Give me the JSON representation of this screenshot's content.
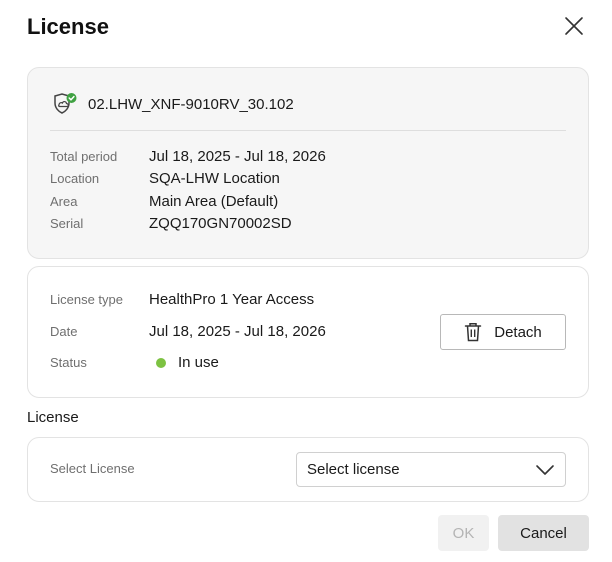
{
  "dialog": {
    "title": "License",
    "close_icon": "close-icon"
  },
  "device": {
    "icon": "shield-check-icon",
    "name": "02.LHW_XNF-9010RV_30.102",
    "fields": [
      {
        "label": "Total period",
        "value": "Jul 18, 2025 - Jul 18, 2026"
      },
      {
        "label": "Location",
        "value": "SQA-LHW Location"
      },
      {
        "label": "Area",
        "value": "Main Area (Default)"
      },
      {
        "label": "Serial",
        "value": "ZQQ170GN70002SD"
      }
    ]
  },
  "current_license": {
    "type_label": "License type",
    "type_value": "HealthPro 1 Year Access",
    "date_label": "Date",
    "date_value": "Jul 18, 2025 - Jul 18, 2026",
    "status_label": "Status",
    "status_value": "In use",
    "status_color": "#7dc242",
    "detach_label": "Detach",
    "detach_icon": "trash-icon"
  },
  "license_section": {
    "heading": "License",
    "select_label": "Select License",
    "select_value": "Select license",
    "select_icon": "chevron-down-icon"
  },
  "footer": {
    "ok_label": "OK",
    "cancel_label": "Cancel"
  }
}
